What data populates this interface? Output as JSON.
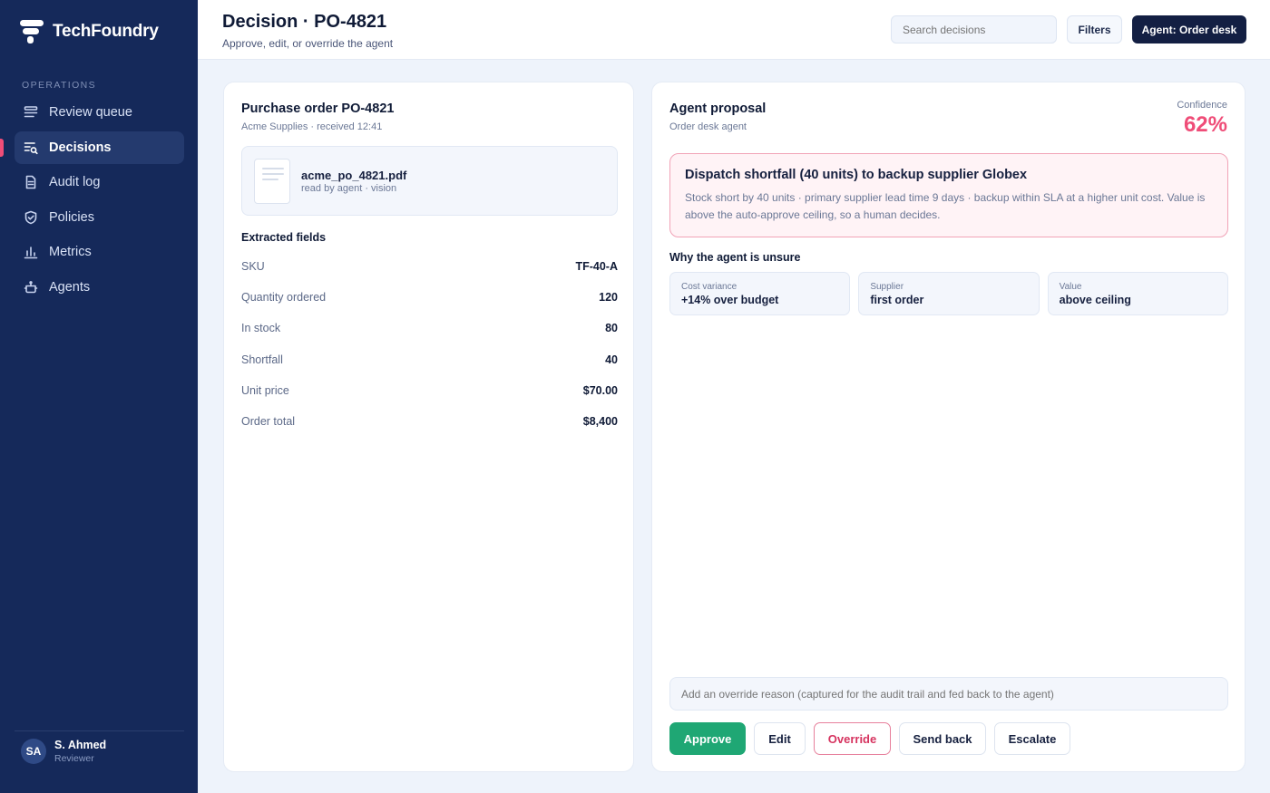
{
  "brand": {
    "name": "TechFoundry"
  },
  "sidebar": {
    "section": "OPERATIONS",
    "items": [
      {
        "label": "Review queue",
        "icon": "list-icon"
      },
      {
        "label": "Decisions",
        "icon": "decisions-icon"
      },
      {
        "label": "Audit log",
        "icon": "document-icon"
      },
      {
        "label": "Policies",
        "icon": "shield-icon"
      },
      {
        "label": "Metrics",
        "icon": "chart-icon"
      },
      {
        "label": "Agents",
        "icon": "bot-icon"
      }
    ],
    "active_index": 1,
    "user": {
      "initials": "SA",
      "name": "S. Ahmed",
      "role": "Reviewer"
    }
  },
  "header": {
    "title": "Decision · PO-4821",
    "subtitle": "Approve, edit, or override the agent",
    "search_placeholder": "Search decisions",
    "filters_label": "Filters",
    "agent_label": "Agent: Order desk"
  },
  "purchase_order": {
    "title": "Purchase order PO-4821",
    "meta": "Acme Supplies · received 12:41",
    "file": {
      "name": "acme_po_4821.pdf",
      "meta": "read by agent · vision"
    },
    "fields_heading": "Extracted fields",
    "fields": [
      {
        "label": "SKU",
        "value": "TF-40-A"
      },
      {
        "label": "Quantity ordered",
        "value": "120"
      },
      {
        "label": "In stock",
        "value": "80"
      },
      {
        "label": "Shortfall",
        "value": "40"
      },
      {
        "label": "Unit price",
        "value": "$70.00"
      },
      {
        "label": "Order total",
        "value": "$8,400"
      }
    ]
  },
  "proposal": {
    "title": "Agent proposal",
    "agent": "Order desk agent",
    "confidence_label": "Confidence",
    "confidence_value": "62%",
    "headline": "Dispatch shortfall (40 units) to backup supplier Globex",
    "body": "Stock short by 40 units · primary supplier lead time 9 days · backup within SLA at a higher unit cost. Value is above the auto-approve ceiling, so a human decides.",
    "unsure_heading": "Why the agent is unsure",
    "reasons": [
      {
        "label": "Cost variance",
        "value": "+14% over budget"
      },
      {
        "label": "Supplier",
        "value": "first order"
      },
      {
        "label": "Value",
        "value": "above ceiling"
      }
    ],
    "override_placeholder": "Add an override reason (captured for the audit trail and fed back to the agent)",
    "actions": {
      "approve": "Approve",
      "edit": "Edit",
      "override": "Override",
      "send_back": "Send back",
      "escalate": "Escalate"
    }
  },
  "colors": {
    "sidebar": "#15295a",
    "accent_pink": "#ef4d78",
    "approve_green": "#1fa774",
    "dark_button": "#131f43"
  }
}
